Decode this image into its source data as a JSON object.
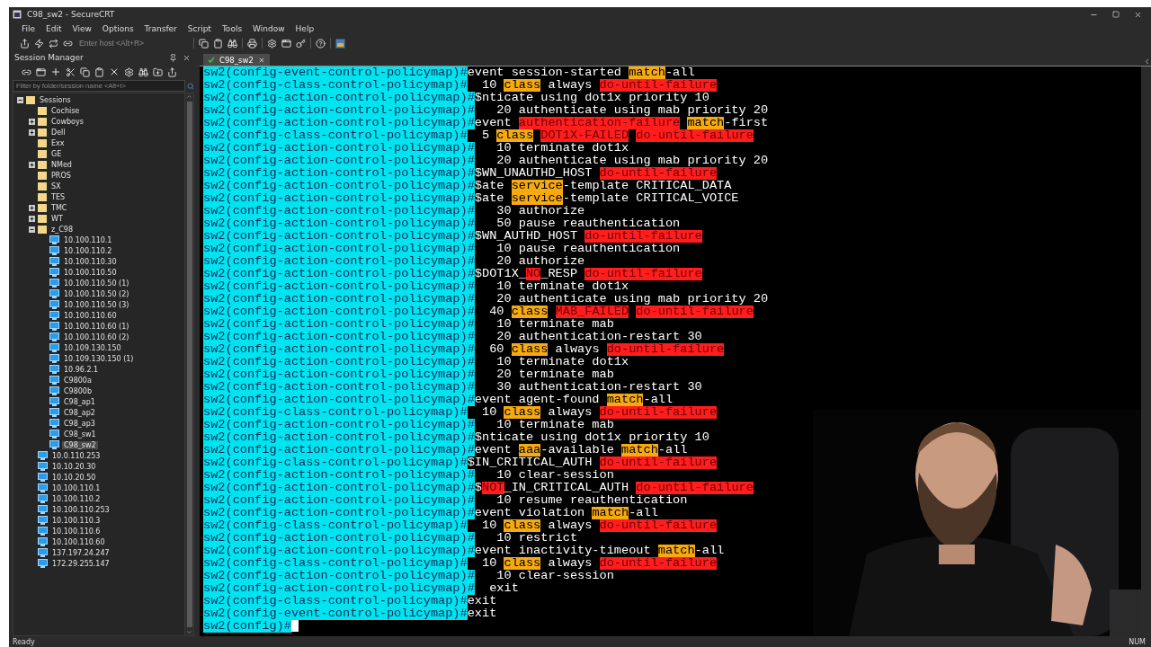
{
  "window": {
    "title": "C98_sw2 - SecureCRT"
  },
  "menu": [
    "File",
    "Edit",
    "View",
    "Options",
    "Transfer",
    "Script",
    "Tools",
    "Window",
    "Help"
  ],
  "toolbar": {
    "host_field": {
      "placeholder": "Enter host <Alt+R>"
    }
  },
  "session_manager": {
    "title": "Session Manager",
    "filter": {
      "placeholder": "Filter by folder/session name <Alt+I>"
    },
    "tree": [
      {
        "label": "Sessions",
        "kind": "folder",
        "expanded": true,
        "selected": false,
        "children": [
          {
            "label": "Cochise",
            "kind": "folder",
            "selected": false
          },
          {
            "label": "Cowboys",
            "kind": "folder",
            "expanded": false,
            "selected": false
          },
          {
            "label": "Dell",
            "kind": "folder",
            "expanded": false,
            "selected": false
          },
          {
            "label": "Exx",
            "kind": "folder",
            "selected": false
          },
          {
            "label": "GE",
            "kind": "folder",
            "selected": false
          },
          {
            "label": "NMed",
            "kind": "folder",
            "expanded": false,
            "selected": false
          },
          {
            "label": "PROS",
            "kind": "folder",
            "selected": false
          },
          {
            "label": "SX",
            "kind": "folder",
            "selected": false
          },
          {
            "label": "TES",
            "kind": "folder",
            "selected": false
          },
          {
            "label": "TMC",
            "kind": "folder",
            "expanded": false,
            "selected": false
          },
          {
            "label": "WT",
            "kind": "folder",
            "expanded": false,
            "selected": false
          },
          {
            "label": "z_C98",
            "kind": "folder",
            "expanded": true,
            "selected": false,
            "children": [
              {
                "label": "10.100.110.1",
                "kind": "host",
                "selected": false
              },
              {
                "label": "10.100.110.2",
                "kind": "host",
                "selected": false
              },
              {
                "label": "10.100.110.30",
                "kind": "host",
                "selected": false
              },
              {
                "label": "10.100.110.50",
                "kind": "host",
                "selected": false
              },
              {
                "label": "10.100.110.50 (1)",
                "kind": "host",
                "selected": false
              },
              {
                "label": "10.100.110.50 (2)",
                "kind": "host",
                "selected": false
              },
              {
                "label": "10.100.110.50 (3)",
                "kind": "host",
                "selected": false
              },
              {
                "label": "10.100.110.60",
                "kind": "host",
                "selected": false
              },
              {
                "label": "10.100.110.60 (1)",
                "kind": "host",
                "selected": false
              },
              {
                "label": "10.100.110.60 (2)",
                "kind": "host",
                "selected": false
              },
              {
                "label": "10.109.130.150",
                "kind": "host",
                "selected": false
              },
              {
                "label": "10.109.130.150 (1)",
                "kind": "host",
                "selected": false
              },
              {
                "label": "10.96.2.1",
                "kind": "host",
                "selected": false
              },
              {
                "label": "C9800a",
                "kind": "host",
                "selected": false
              },
              {
                "label": "C9800b",
                "kind": "host",
                "selected": false
              },
              {
                "label": "C98_ap1",
                "kind": "host",
                "selected": false
              },
              {
                "label": "C98_ap2",
                "kind": "host",
                "selected": false
              },
              {
                "label": "C98_ap3",
                "kind": "host",
                "selected": false
              },
              {
                "label": "C98_sw1",
                "kind": "host",
                "selected": false
              },
              {
                "label": "C98_sw2",
                "kind": "host",
                "selected": true
              }
            ]
          },
          {
            "label": "10.0.110.253",
            "kind": "host",
            "selected": false
          },
          {
            "label": "10.10.20.30",
            "kind": "host",
            "selected": false
          },
          {
            "label": "10.10.20.50",
            "kind": "host",
            "selected": false
          },
          {
            "label": "10.100.110.1",
            "kind": "host",
            "selected": false
          },
          {
            "label": "10.100.110.2",
            "kind": "host",
            "selected": false
          },
          {
            "label": "10.100.110.253",
            "kind": "host",
            "selected": false
          },
          {
            "label": "10.100.110.3",
            "kind": "host",
            "selected": false
          },
          {
            "label": "10.100.110.6",
            "kind": "host",
            "selected": false
          },
          {
            "label": "10.100.110.60",
            "kind": "host",
            "selected": false
          },
          {
            "label": "137.197.24.247",
            "kind": "host",
            "selected": false
          },
          {
            "label": "172.29.255.147",
            "kind": "host",
            "selected": false
          }
        ]
      }
    ]
  },
  "tabs": [
    {
      "label": "C98_sw2",
      "selected": true
    }
  ],
  "terminal": {
    "lines": [
      {
        "prompt": "sw2(config-event-control-policymap)#",
        "segments": [
          {
            "text": "event session-started "
          },
          {
            "text": "match",
            "color": "#f7aa10"
          },
          {
            "text": "-all"
          }
        ]
      },
      {
        "prompt": "sw2(config-class-control-policymap)#",
        "segments": [
          {
            "text": "  10 "
          },
          {
            "text": "class",
            "color": "#f7aa10"
          },
          {
            "text": " always "
          },
          {
            "text": "do-until-failure",
            "color": "#ff1d1d"
          }
        ]
      },
      {
        "prompt": "sw2(config-action-control-policymap)#",
        "segments": [
          {
            "text": "$nticate using dot1x priority 10"
          }
        ]
      },
      {
        "prompt": "sw2(config-action-control-policymap)#",
        "segments": [
          {
            "text": "   20 authenticate using mab priority 20"
          }
        ]
      },
      {
        "prompt": "sw2(config-action-control-policymap)#",
        "segments": [
          {
            "text": "event "
          },
          {
            "text": "authentication-failure",
            "color": "#ff1d1d"
          },
          {
            "text": "match",
            "color": "#f7aa10",
            "space_before": true
          },
          {
            "text": "-first"
          }
        ]
      },
      {
        "prompt": "sw2(config-class-control-policymap)#",
        "segments": [
          {
            "text": "  5 "
          },
          {
            "text": "class",
            "color": "#f7aa10"
          },
          {
            "text": "DOT1X-FAILED",
            "color": "#ff1d1d",
            "space_before": true
          },
          {
            "text": "do-until-failure",
            "color": "#ff1d1d",
            "space_before": true
          }
        ]
      },
      {
        "prompt": "sw2(config-action-control-policymap)#",
        "segments": [
          {
            "text": "   10 terminate dot1x"
          }
        ]
      },
      {
        "prompt": "sw2(config-action-control-policymap)#",
        "segments": [
          {
            "text": "   20 authenticate using mab priority 20"
          }
        ]
      },
      {
        "prompt": "sw2(config-action-control-policymap)#",
        "segments": [
          {
            "text": "$WN_UNAUTHD_HOST "
          },
          {
            "text": "do-until-failure",
            "color": "#ff1d1d"
          }
        ]
      },
      {
        "prompt": "sw2(config-action-control-policymap)#",
        "segments": [
          {
            "text": "$ate "
          },
          {
            "text": "service",
            "color": "#f7aa10"
          },
          {
            "text": "-template CRITICAL_DATA"
          }
        ]
      },
      {
        "prompt": "sw2(config-action-control-policymap)#",
        "segments": [
          {
            "text": "$ate "
          },
          {
            "text": "service",
            "color": "#f7aa10"
          },
          {
            "text": "-template CRITICAL_VOICE"
          }
        ]
      },
      {
        "prompt": "sw2(config-action-control-policymap)#",
        "segments": [
          {
            "text": "   30 authorize"
          }
        ]
      },
      {
        "prompt": "sw2(config-action-control-policymap)#",
        "segments": [
          {
            "text": "   50 pause reauthentication"
          }
        ]
      },
      {
        "prompt": "sw2(config-action-control-policymap)#",
        "segments": [
          {
            "text": "$WN_AUTHD_HOST "
          },
          {
            "text": "do-until-failure",
            "color": "#ff1d1d"
          }
        ]
      },
      {
        "prompt": "sw2(config-action-control-policymap)#",
        "segments": [
          {
            "text": "   10 pause reauthentication"
          }
        ]
      },
      {
        "prompt": "sw2(config-action-control-policymap)#",
        "segments": [
          {
            "text": "   20 authorize"
          }
        ]
      },
      {
        "prompt": "sw2(config-action-control-policymap)#",
        "segments": [
          {
            "text": "$DOT1X_"
          },
          {
            "text": "NO",
            "color": "#ff1d1d"
          },
          {
            "text": "_RESP "
          },
          {
            "text": "do-until-failure",
            "color": "#ff1d1d"
          }
        ]
      },
      {
        "prompt": "sw2(config-action-control-policymap)#",
        "segments": [
          {
            "text": "   10 terminate dot1x"
          }
        ]
      },
      {
        "prompt": "sw2(config-action-control-policymap)#",
        "segments": [
          {
            "text": "   20 authenticate using mab priority 20"
          }
        ]
      },
      {
        "prompt": "sw2(config-action-control-policymap)#",
        "segments": [
          {
            "text": "  40 "
          },
          {
            "text": "class",
            "color": "#f7aa10"
          },
          {
            "text": "MAB_FAILED",
            "color": "#ff1d1d",
            "space_before": true
          },
          {
            "text": "do-until-failure",
            "color": "#ff1d1d",
            "space_before": true
          }
        ]
      },
      {
        "prompt": "sw2(config-action-control-policymap)#",
        "segments": [
          {
            "text": "   10 terminate mab"
          }
        ]
      },
      {
        "prompt": "sw2(config-action-control-policymap)#",
        "segments": [
          {
            "text": "   20 authentication-restart 30"
          }
        ]
      },
      {
        "prompt": "sw2(config-action-control-policymap)#",
        "segments": [
          {
            "text": "  60 "
          },
          {
            "text": "class",
            "color": "#f7aa10"
          },
          {
            "text": " always "
          },
          {
            "text": "do-until-failure",
            "color": "#ff1d1d"
          }
        ]
      },
      {
        "prompt": "sw2(config-action-control-policymap)#",
        "segments": [
          {
            "text": "   10 terminate dot1x"
          }
        ]
      },
      {
        "prompt": "sw2(config-action-control-policymap)#",
        "segments": [
          {
            "text": "   20 terminate mab"
          }
        ]
      },
      {
        "prompt": "sw2(config-action-control-policymap)#",
        "segments": [
          {
            "text": "   30 authentication-restart 30"
          }
        ]
      },
      {
        "prompt": "sw2(config-action-control-policymap)#",
        "segments": [
          {
            "text": "event agent-found "
          },
          {
            "text": "match",
            "color": "#f7aa10"
          },
          {
            "text": "-all"
          }
        ]
      },
      {
        "prompt": "sw2(config-class-control-policymap)#",
        "segments": [
          {
            "text": "  10 "
          },
          {
            "text": "class",
            "color": "#f7aa10"
          },
          {
            "text": " always "
          },
          {
            "text": "do-until-failure",
            "color": "#ff1d1d"
          }
        ]
      },
      {
        "prompt": "sw2(config-action-control-policymap)#",
        "segments": [
          {
            "text": "   10 terminate mab"
          }
        ]
      },
      {
        "prompt": "sw2(config-action-control-policymap)#",
        "segments": [
          {
            "text": "$nticate using dot1x priority 10"
          }
        ]
      },
      {
        "prompt": "sw2(config-action-control-policymap)#",
        "segments": [
          {
            "text": "event "
          },
          {
            "text": "aaa",
            "color": "#f7aa10"
          },
          {
            "text": "-available "
          },
          {
            "text": "match",
            "color": "#f7aa10"
          },
          {
            "text": "-all"
          }
        ]
      },
      {
        "prompt": "sw2(config-class-control-policymap)#",
        "segments": [
          {
            "text": "$IN_CRITICAL_AUTH "
          },
          {
            "text": "do-until-failure",
            "color": "#ff1d1d"
          }
        ]
      },
      {
        "prompt": "sw2(config-action-control-policymap)#",
        "segments": [
          {
            "text": "   10 clear-session"
          }
        ]
      },
      {
        "prompt": "sw2(config-action-control-policymap)#",
        "segments": [
          {
            "text": "$"
          },
          {
            "text": "NOT",
            "color": "#ff1d1d"
          },
          {
            "text": "_IN_CRITICAL_AUTH "
          },
          {
            "text": "do-until-failure",
            "color": "#ff1d1d"
          }
        ]
      },
      {
        "prompt": "sw2(config-action-control-policymap)#",
        "segments": [
          {
            "text": "   10 resume reauthentication"
          }
        ]
      },
      {
        "prompt": "sw2(config-action-control-policymap)#",
        "segments": [
          {
            "text": "event violation "
          },
          {
            "text": "match",
            "color": "#f7aa10"
          },
          {
            "text": "-all"
          }
        ]
      },
      {
        "prompt": "sw2(config-class-control-policymap)#",
        "segments": [
          {
            "text": "  10 "
          },
          {
            "text": "class",
            "color": "#f7aa10"
          },
          {
            "text": " always "
          },
          {
            "text": "do-until-failure",
            "color": "#ff1d1d"
          }
        ]
      },
      {
        "prompt": "sw2(config-action-control-policymap)#",
        "segments": [
          {
            "text": "   10 restrict"
          }
        ]
      },
      {
        "prompt": "sw2(config-action-control-policymap)#",
        "segments": [
          {
            "text": "event inactivity-timeout "
          },
          {
            "text": "match",
            "color": "#f7aa10"
          },
          {
            "text": "-all"
          }
        ]
      },
      {
        "prompt": "sw2(config-class-control-policymap)#",
        "segments": [
          {
            "text": "  10 "
          },
          {
            "text": "class",
            "color": "#f7aa10"
          },
          {
            "text": " always "
          },
          {
            "text": "do-until-failure",
            "color": "#ff1d1d"
          }
        ]
      },
      {
        "prompt": "sw2(config-action-control-policymap)#",
        "segments": [
          {
            "text": "   10 clear-session"
          }
        ]
      },
      {
        "prompt": "sw2(config-action-control-policymap)#",
        "segments": [
          {
            "text": "  exit"
          }
        ]
      },
      {
        "prompt": "sw2(config-class-control-policymap)#",
        "segments": [
          {
            "text": "exit"
          }
        ]
      },
      {
        "prompt": "sw2(config-event-control-policymap)#",
        "segments": [
          {
            "text": "exit"
          }
        ]
      },
      {
        "prompt": "sw2(config)#",
        "cursor": true
      }
    ]
  },
  "status_bar": {
    "left": "Ready",
    "right": "NUM"
  }
}
